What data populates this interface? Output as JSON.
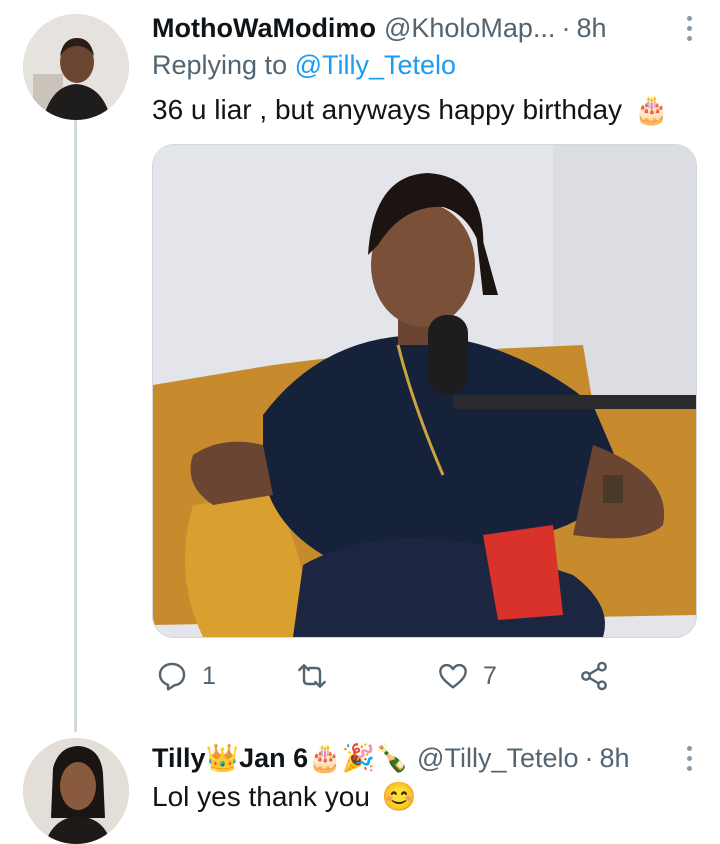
{
  "tweet1": {
    "display_name": "MothoWaModimo",
    "handle": "@KholoMap...",
    "separator": "·",
    "time": "8h",
    "replying_prefix": "Replying to",
    "replying_to": "@Tilly_Tetelo",
    "text": "36 u liar , but anyways happy birthday",
    "text_emoji": "🎂",
    "actions": {
      "reply_count": "1",
      "retweet_count": "",
      "like_count": "7"
    }
  },
  "tweet2": {
    "display_name": "Tilly👑Jan 6🎂🎉🍾",
    "handle": "@Tilly_Tetelo",
    "separator": "·",
    "time": "8h",
    "text": "Lol yes thank you",
    "text_emoji": "😊"
  },
  "colors": {
    "text": "#0f1419",
    "secondary": "#536471",
    "link": "#1d9bf0",
    "thread_line": "#cfd9de"
  }
}
